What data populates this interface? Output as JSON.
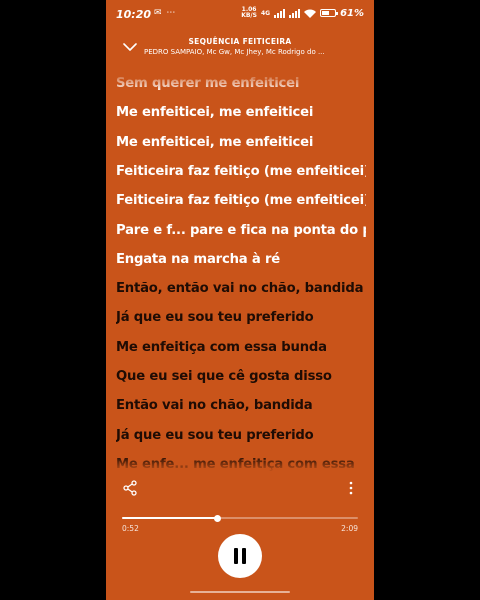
{
  "status_bar": {
    "time": "10:20",
    "indicators": "✉ ⋯",
    "network_speed_value": "1.06",
    "network_speed_unit": "KB/S",
    "network_type": "4G",
    "battery_percent": "61%",
    "battery_level": 0.61
  },
  "header": {
    "title": "SEQUÊNCIA FEITICEIRA",
    "artists": "PEDRO SAMPAIO, Mc Gw, Mc Jhey, Mc Rodrigo do ..."
  },
  "lyrics": {
    "lines": [
      {
        "text": "Sem querer me enfeiticei",
        "state": "sung"
      },
      {
        "text": "Me enfeiticei, me enfeiticei",
        "state": "sung"
      },
      {
        "text": "Me enfeiticei, me enfeiticei",
        "state": "sung"
      },
      {
        "text": "Feiticeira faz feitiço (me enfeiticei)",
        "state": "sung"
      },
      {
        "text": "Feiticeira faz feitiço (me enfeiticei)",
        "state": "sung"
      },
      {
        "text": "Pare e f... pare e fica na ponta do pé",
        "state": "sung"
      },
      {
        "text": "Engata na marcha à ré",
        "state": "sung"
      },
      {
        "text": "Então, então vai no chão, bandida",
        "state": "upcoming"
      },
      {
        "text": "Já que eu sou teu preferido",
        "state": "upcoming"
      },
      {
        "text": "Me enfeitiça com essa bunda",
        "state": "upcoming"
      },
      {
        "text": "Que eu sei que cê gosta disso",
        "state": "upcoming"
      },
      {
        "text": "Então vai no chão, bandida",
        "state": "upcoming"
      },
      {
        "text": "Já que eu sou teu preferido",
        "state": "upcoming"
      },
      {
        "text": "Me enfe... me enfeitiça com essa",
        "state": "upcoming"
      }
    ]
  },
  "player": {
    "elapsed": "0:52",
    "total": "2:09",
    "progress": 0.403,
    "state": "playing"
  },
  "colors": {
    "background": "#c9541a",
    "sung_text": "#ffffff",
    "upcoming_text": "#1f0c04"
  },
  "icons": {
    "collapse": "chevron-down-icon",
    "share": "share-icon",
    "more": "more-vertical-icon",
    "pause": "pause-icon"
  }
}
